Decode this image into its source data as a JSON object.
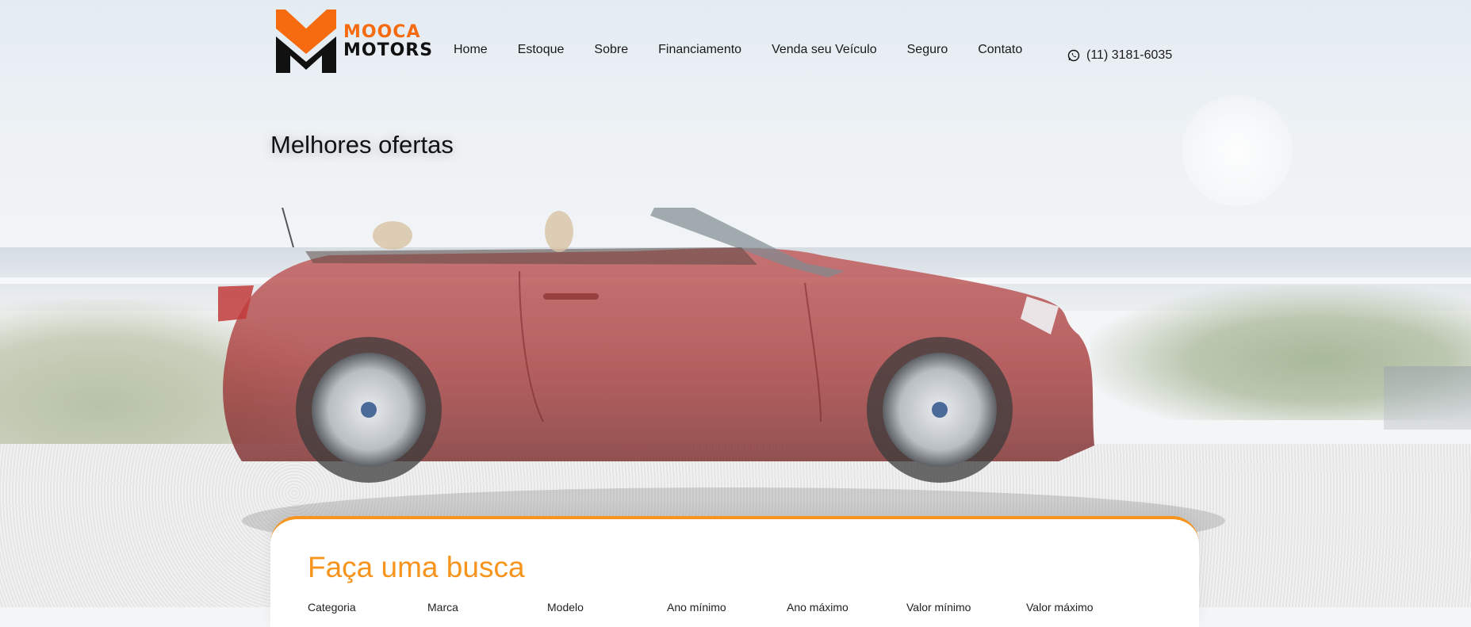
{
  "logo": {
    "line1": "MOOCA",
    "line2": "MOTORS",
    "brand_orange": "#f66b10",
    "brand_black": "#111111"
  },
  "nav": {
    "items": [
      {
        "label": "Home"
      },
      {
        "label": "Estoque"
      },
      {
        "label": "Sobre"
      },
      {
        "label": "Financiamento"
      },
      {
        "label": "Venda seu Veículo"
      },
      {
        "label": "Seguro"
      },
      {
        "label": "Contato"
      }
    ]
  },
  "phone": {
    "icon": "whatsapp-icon",
    "number": "(11) 3181-6035"
  },
  "hero": {
    "title": "Melhores ofertas"
  },
  "search": {
    "title": "Faça uma busca",
    "accent_color": "#f7941d",
    "filters": [
      {
        "label": "Categoria"
      },
      {
        "label": "Marca"
      },
      {
        "label": "Modelo"
      },
      {
        "label": "Ano mínimo"
      },
      {
        "label": "Ano máximo"
      },
      {
        "label": "Valor mínimo"
      },
      {
        "label": "Valor máximo"
      }
    ]
  }
}
